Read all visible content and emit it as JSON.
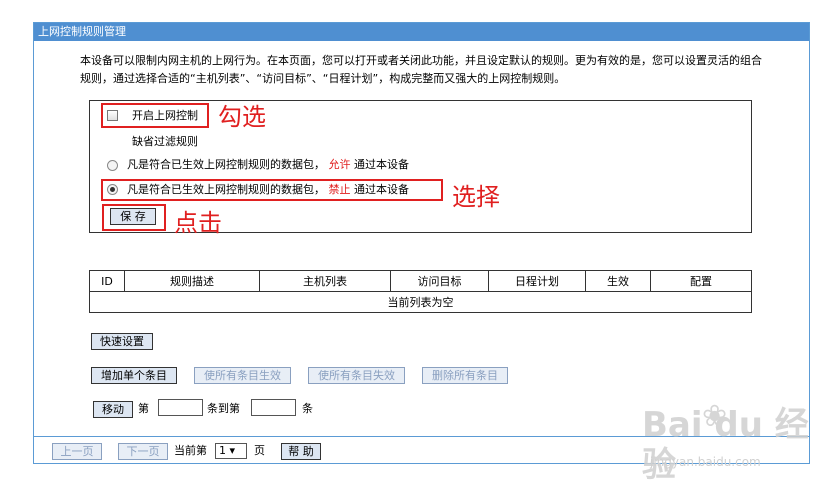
{
  "window": {
    "title": "上网控制规则管理"
  },
  "description": "本设备可以限制内网主机的上网行为。在本页面，您可以打开或者关闭此功能，并且设定默认的规则。更为有效的是，您可以设置灵活的组合规则，通过选择合适的“主机列表”、“访问目标”、“日程计划”，构成完整而又强大的上网控制规则。",
  "settings": {
    "enable_label": "开启上网控制",
    "enable_checked": false,
    "default_rule_title": "缺省过滤规则",
    "option_allow": {
      "prefix": "凡是符合已生效上网控制规则的数据包，",
      "keyword": "允许",
      "suffix": "通过本设备",
      "selected": false
    },
    "option_deny": {
      "prefix": "凡是符合已生效上网控制规则的数据包，",
      "keyword": "禁止",
      "suffix": "通过本设备",
      "selected": true
    },
    "save_label": "保 存"
  },
  "annotations": {
    "check": "勾选",
    "select": "选择",
    "click": "点击"
  },
  "table": {
    "columns": [
      "ID",
      "规则描述",
      "主机列表",
      "访问目标",
      "日程计划",
      "生效",
      "配置"
    ],
    "empty_text": "当前列表为空"
  },
  "actions": {
    "quick_setup": "快速设置",
    "add_entry": "增加单个条目",
    "enable_all": "使所有条目生效",
    "disable_all": "使所有条目失效",
    "delete_all": "删除所有条目",
    "move": "移动",
    "move_prefix": "第",
    "move_mid": "条到第",
    "move_suffix": "条"
  },
  "pagination": {
    "prev": "上一页",
    "next": "下一页",
    "current_prefix": "当前第",
    "current_page": "1 ▾",
    "suffix": "页",
    "help": "帮 助"
  },
  "watermark": {
    "logo": "Bai du 经验",
    "url": "jingyan.baidu.com"
  },
  "colors": {
    "title_bar": "#4f8fd1",
    "annotation_red": "#e02020",
    "button_bg": "#dde6f2"
  }
}
